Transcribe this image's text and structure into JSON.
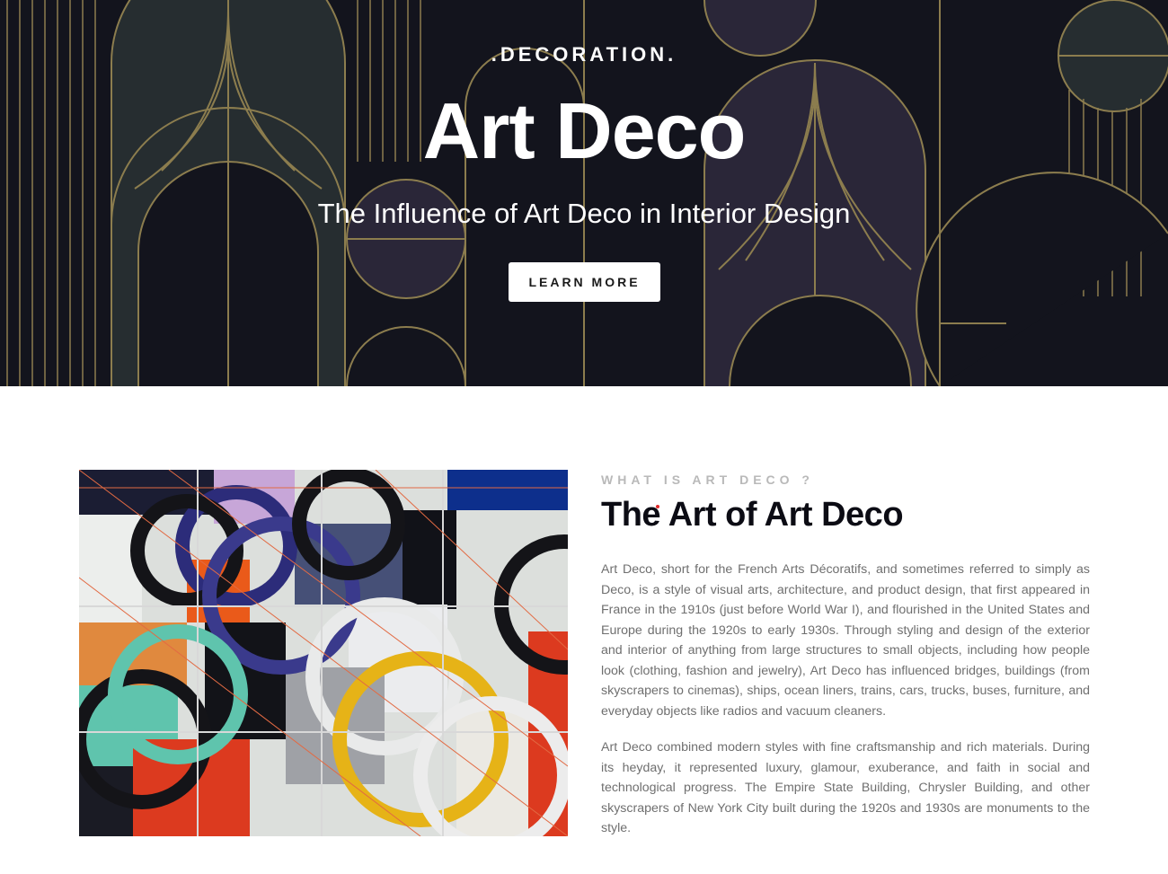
{
  "hero": {
    "eyebrow": ".DECORATION.",
    "title": "Art Deco",
    "subtitle": "The Influence of Art Deco in Interior Design",
    "button_label": "LEARN MORE"
  },
  "about": {
    "kicker": "WHAT IS ART DECO ?",
    "title": "The Art of Art Deco",
    "paragraphs": [
      "Art Deco, short for the French Arts Décoratifs, and sometimes referred to simply as Deco, is a style of visual arts, architecture, and product design, that first appeared in France in the 1910s (just before World War I), and flourished in the United States and Europe during the 1920s to early 1930s. Through styling and design of the exterior and interior of anything from large structures to small objects, including how people look (clothing, fashion and jewelry), Art Deco has influenced bridges, buildings (from skyscrapers to cinemas), ships, ocean liners, trains, cars, trucks, buses, furniture, and everyday objects like radios and vacuum cleaners.",
      "Art Deco combined modern styles with fine craftsmanship and rich materials. During its heyday, it represented luxury, glamour, exuberance, and faith in social and technological progress. The Empire State Building, Chrysler Building, and other skyscrapers of New York City built during the 1920s and 1930s are monuments to the style."
    ]
  },
  "colors": {
    "hero_bg": "#13141d",
    "gold_line": "#8c7d4e",
    "accent_dot": "#e02a2a",
    "body_text": "#6f6f6f",
    "kicker_text": "#b9b9b9"
  }
}
